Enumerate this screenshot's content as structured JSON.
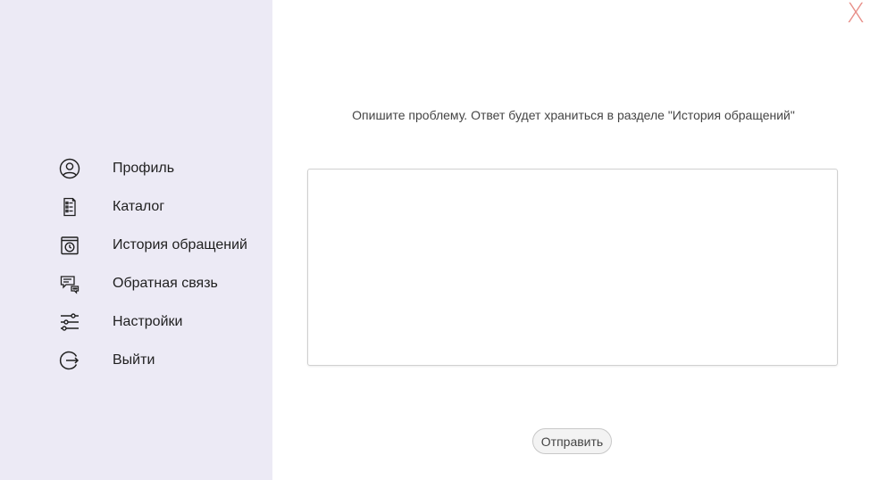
{
  "sidebar": {
    "items": [
      {
        "label": "Профиль",
        "icon": "user-circle-icon"
      },
      {
        "label": "Каталог",
        "icon": "catalog-icon"
      },
      {
        "label": "История обращений",
        "icon": "history-clock-icon"
      },
      {
        "label": "Обратная связь",
        "icon": "feedback-chat-icon"
      },
      {
        "label": "Настройки",
        "icon": "sliders-icon"
      },
      {
        "label": "Выйти",
        "icon": "logout-icon"
      }
    ]
  },
  "window": {
    "close_label": "X",
    "close_color": "#e8908a"
  },
  "main": {
    "prompt": "Опишите проблему. Ответ будет храниться в разделе \"История обращений\"",
    "message_value": "",
    "send_label": "Отправить"
  },
  "colors": {
    "sidebar_bg": "#eceaf5",
    "page_bg": "#ffffff"
  }
}
